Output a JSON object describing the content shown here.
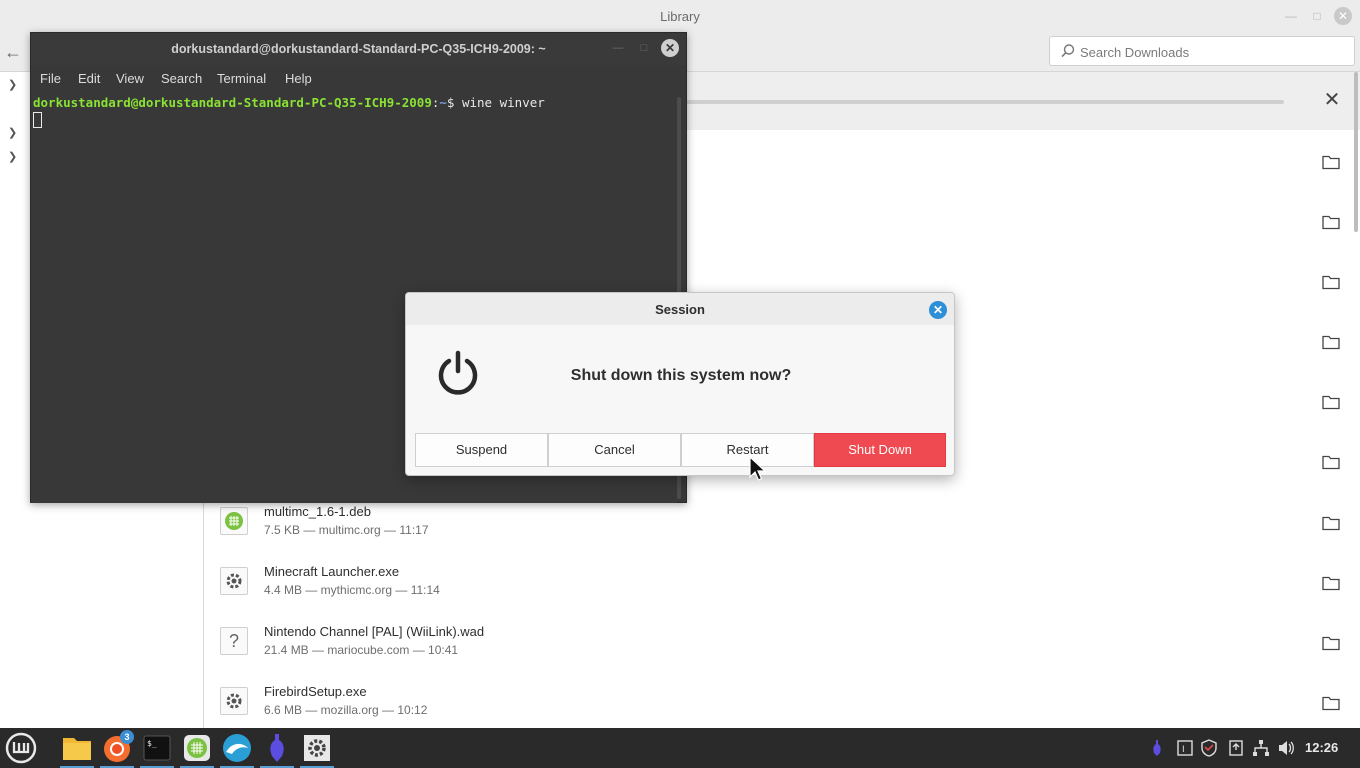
{
  "library": {
    "title": "Library",
    "search_placeholder": "Search Downloads",
    "downloads": [
      {
        "name": "multimc_1.6-1.deb",
        "meta": "7.5 KB — multimc.org — 11:17",
        "icon": "package-icon"
      },
      {
        "name": "Minecraft Launcher.exe",
        "meta": "4.4 MB — mythicmc.org — 11:14",
        "icon": "gear-icon"
      },
      {
        "name": "Nintendo Channel [PAL] (WiiLink).wad",
        "meta": "21.4 MB — mariocube.com — 10:41",
        "icon": "question-icon"
      },
      {
        "name": "FirebirdSetup.exe",
        "meta": "6.6 MB — mozilla.org — 10:12",
        "icon": "gear-icon"
      }
    ]
  },
  "terminal": {
    "title": "dorkustandard@dorkustandard-Standard-PC-Q35-ICH9-2009: ~",
    "menu": [
      "File",
      "Edit",
      "View",
      "Search",
      "Terminal",
      "Help"
    ],
    "prompt_user": "dorkustandard@dorkustandard-Standard-PC-Q35-ICH9-2009",
    "prompt_sep": ":",
    "prompt_path": "~",
    "prompt_symbol": "$ ",
    "command": "wine winver"
  },
  "session": {
    "title": "Session",
    "message": "Shut down this system now?",
    "buttons": {
      "suspend": "Suspend",
      "cancel": "Cancel",
      "restart": "Restart",
      "shutdown": "Shut Down"
    },
    "shutdown_color": "#ef4a51"
  },
  "taskbar": {
    "firefox_badge": "3",
    "clock": "12:26",
    "apps": [
      "menu-icon",
      "files-icon",
      "firefox-icon",
      "terminal-icon",
      "multimc-icon",
      "dolphin-icon",
      "bottle-icon",
      "settings-icon"
    ]
  }
}
